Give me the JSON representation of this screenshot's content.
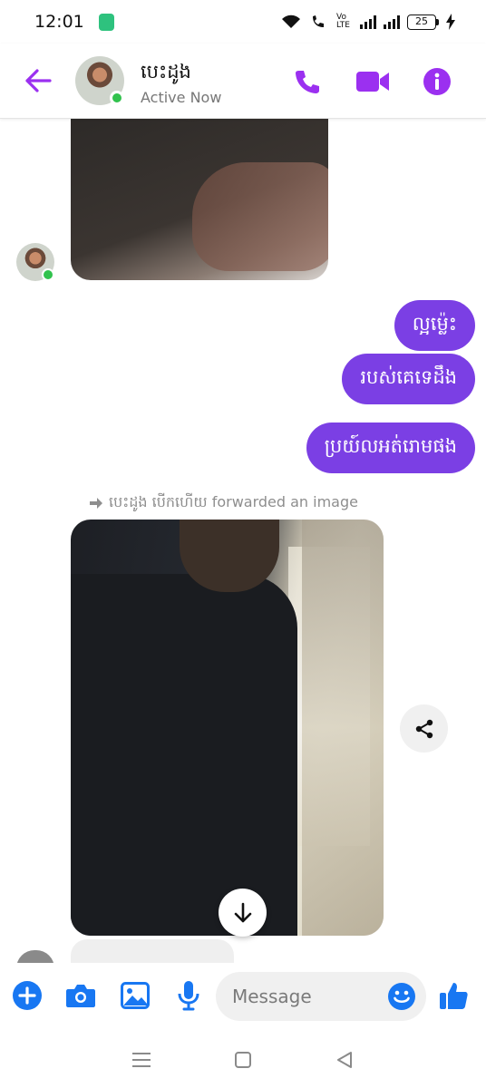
{
  "status_bar": {
    "time": "12:01",
    "battery_level": "25",
    "network_label": "Vo LTE"
  },
  "header": {
    "contact_name": "បេះដូង",
    "presence": "Active Now"
  },
  "messages": {
    "outgoing": [
      "ល្អម្ល៉េះ",
      "របស់គេទេដឹង",
      "ប្រយ៍លអត់រោមផង"
    ],
    "forward_note": "បេះដូង បើកហើយ forwarded an image"
  },
  "composer": {
    "placeholder": "Message"
  },
  "colors": {
    "accent": "#7b3fe4",
    "header_icon": "#9b30f0",
    "composer_icon": "#1877f2",
    "online": "#31c24d"
  },
  "icons": {
    "back": "arrow-left-icon",
    "call": "phone-icon",
    "video": "video-camera-icon",
    "info": "info-icon",
    "share": "share-icon",
    "scroll": "arrow-down-icon",
    "add": "plus-icon",
    "camera": "camera-icon",
    "gallery": "image-icon",
    "mic": "microphone-icon",
    "emoji": "emoji-icon",
    "like": "thumbs-up-icon"
  }
}
